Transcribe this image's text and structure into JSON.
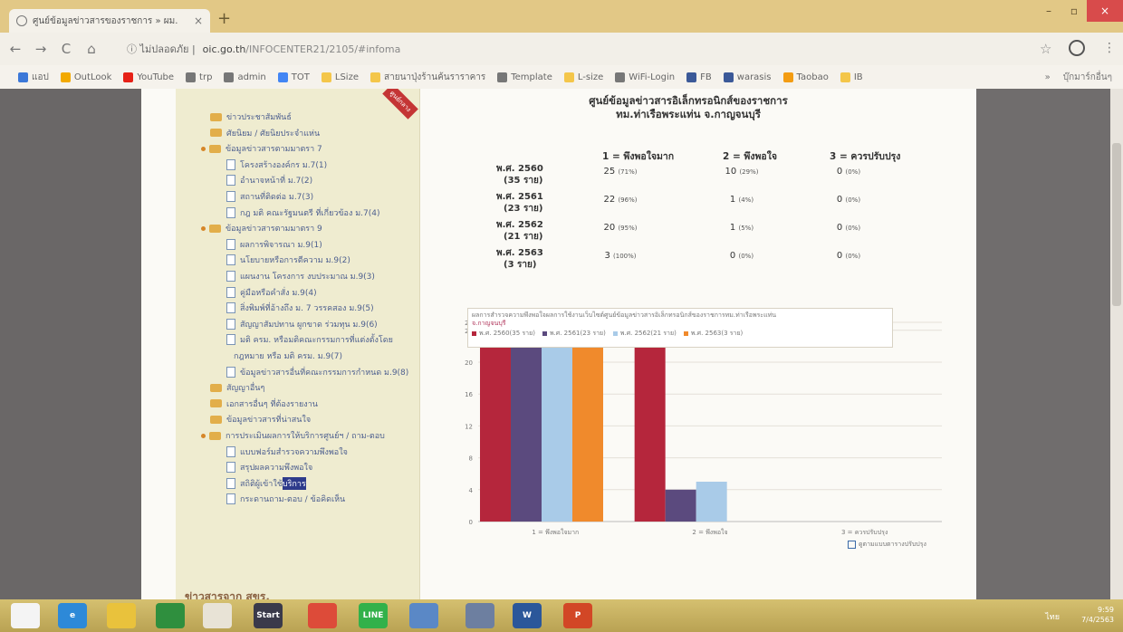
{
  "browser": {
    "tab_title": "ศูนย์ข้อมูลข่าวสารของราชการ » ผม.",
    "tab_close": "×",
    "new_tab": "+",
    "security_label": "ไม่ปลอดภัย",
    "url_domain": "oic.go.th",
    "url_path": "/INFOCENTER21/2105/#infoma",
    "nav_back": "←",
    "nav_forward": "→",
    "nav_reload": "C",
    "nav_home": "⌂",
    "window_controls": {
      "minimize": "–",
      "maximize": "▫",
      "close": "×"
    },
    "bookmarks": [
      {
        "label": "แอป",
        "color": "#3c78d8",
        "icon": "apps-icon"
      },
      {
        "label": "OutLook",
        "color": "#f2a900",
        "icon": "outlook-icon"
      },
      {
        "label": "YouTube",
        "color": "#e62117",
        "icon": "youtube-icon"
      },
      {
        "label": "trp",
        "color": "#777777",
        "icon": "globe-icon"
      },
      {
        "label": "admin",
        "color": "#777777",
        "icon": "globe-icon"
      },
      {
        "label": "TOT",
        "color": "#4285f4",
        "icon": "google-icon"
      },
      {
        "label": "LSize",
        "color": "#f4c64a",
        "icon": "folder-icon"
      },
      {
        "label": "สายนาปุ่งร้านค้นราราคาร",
        "color": "#f4c64a",
        "icon": "folder-icon"
      },
      {
        "label": "Template",
        "color": "#777777",
        "icon": "globe-icon"
      },
      {
        "label": "L-size",
        "color": "#f4c64a",
        "icon": "folder-icon"
      },
      {
        "label": "WiFi-Login",
        "color": "#777777",
        "icon": "globe-icon"
      },
      {
        "label": "FB",
        "color": "#3b5998",
        "icon": "facebook-icon"
      },
      {
        "label": "warasis",
        "color": "#3b5998",
        "icon": "facebook-icon"
      },
      {
        "label": "Taobao",
        "color": "#f39c12",
        "icon": "taobao-icon"
      },
      {
        "label": "IB",
        "color": "#f4c64a",
        "icon": "ib-icon"
      }
    ],
    "bookmarks_more": "»",
    "other_bookmarks": "บุ๊กมาร์กอื่นๆ"
  },
  "sidebar": {
    "ribbon": "ศูนย์กลาง",
    "items": [
      {
        "type": "folder",
        "dot": false,
        "indent": 0,
        "label": "ข่าวประชาสัมพันธ์"
      },
      {
        "type": "folder",
        "dot": false,
        "indent": 0,
        "label": "ศัยนิยม / ศัยนิยประจำแห่น"
      },
      {
        "type": "folder",
        "dot": true,
        "indent": 0,
        "label": "ข้อมูลข่าวสารตามมาตรา 7"
      },
      {
        "type": "doc",
        "dot": false,
        "indent": 1,
        "label": "โครงสร้างองค์กร ม.7(1)"
      },
      {
        "type": "doc",
        "dot": false,
        "indent": 1,
        "label": "อำนาจหน้าที่ ม.7(2)"
      },
      {
        "type": "doc",
        "dot": false,
        "indent": 1,
        "label": "สถานที่ติดต่อ ม.7(3)"
      },
      {
        "type": "doc",
        "dot": false,
        "indent": 1,
        "label": "กฎ มติ คณะรัฐมนตรี ที่เกี่ยวข้อง ม.7(4)"
      },
      {
        "type": "folder",
        "dot": true,
        "indent": 0,
        "label": "ข้อมูลข่าวสารตามมาตรา 9"
      },
      {
        "type": "doc",
        "dot": false,
        "indent": 1,
        "label": "ผลการพิจารณา ม.9(1)"
      },
      {
        "type": "doc",
        "dot": false,
        "indent": 1,
        "label": "นโยบายหรือการตีความ ม.9(2)"
      },
      {
        "type": "doc",
        "dot": false,
        "indent": 1,
        "label": "แผนงาน โครงการ งบประมาณ ม.9(3)"
      },
      {
        "type": "doc",
        "dot": false,
        "indent": 1,
        "label": "คู่มือหรือคำสั่ง ม.9(4)"
      },
      {
        "type": "doc",
        "dot": false,
        "indent": 1,
        "label": "สิ่งพิมพ์ที่อ้างถึง ม. 7 วรรคสอง ม.9(5)"
      },
      {
        "type": "doc",
        "dot": false,
        "indent": 1,
        "label": "สัญญาสัมปทาน ผูกขาด ร่วมทุน ม.9(6)"
      },
      {
        "type": "doc",
        "dot": false,
        "indent": 1,
        "label": "มติ ครม. หรือมติคณะกรรมการที่แต่งตั้งโดย"
      },
      {
        "type": "text",
        "dot": false,
        "indent": 2,
        "label": "กฎหมาย หรือ มติ ครม. ม.9(7)"
      },
      {
        "type": "doc",
        "dot": false,
        "indent": 1,
        "label": "ข้อมูลข่าวสารอื่นที่คณะกรรมการกำหนด ม.9(8)"
      },
      {
        "type": "folder",
        "dot": false,
        "indent": 0,
        "label": "สัญญาอื่นๆ"
      },
      {
        "type": "folder",
        "dot": false,
        "indent": 0,
        "label": "เอกสารอื่นๆ ที่ต้องรายงาน"
      },
      {
        "type": "folder",
        "dot": false,
        "indent": 0,
        "label": "ข้อมูลข่าวสารที่น่าสนใจ"
      },
      {
        "type": "folder",
        "dot": true,
        "indent": 0,
        "label": "การประเมินผลการให้บริการศูนย์ฯ / ถาม-ตอบ"
      },
      {
        "type": "doc",
        "dot": false,
        "indent": 1,
        "label": "แบบฟอร์มสำรวจความพึงพอใจ"
      },
      {
        "type": "doc",
        "dot": false,
        "indent": 1,
        "label": "สรุปผลความพึงพอใจ"
      },
      {
        "type": "doc",
        "dot": false,
        "indent": 1,
        "label": "สถิติผู้เข้าใช้บริการ",
        "selected_part": "บริการ"
      },
      {
        "type": "doc",
        "dot": false,
        "indent": 1,
        "label": "กระดานถาม-ตอบ / ข้อคิดเห็น"
      }
    ],
    "news_title": "ข่าวสารจาก สขร."
  },
  "main": {
    "title_line1": "ศูนย์ข้อมูลข่าวสารอิเล็กทรอนิกส์ของราชการ",
    "title_line2": "ทม.ท่าเรือพระแท่น จ.กาญจนบุรี",
    "columns": [
      "1 = พึงพอใจมาก",
      "2 = พึงพอใจ",
      "3 = ควรปรับปรุง"
    ],
    "rows": [
      {
        "year": "พ.ศ. 2560",
        "count": "(35 ราย)",
        "c1": "25",
        "p1": "(71%)",
        "c2": "10",
        "p2": "(29%)",
        "c3": "0",
        "p3": "(0%)"
      },
      {
        "year": "พ.ศ. 2561",
        "count": "(23 ราย)",
        "c1": "22",
        "p1": "(96%)",
        "c2": "1",
        "p2": "(4%)",
        "c3": "0",
        "p3": "(0%)"
      },
      {
        "year": "พ.ศ. 2562",
        "count": "(21 ราย)",
        "c1": "20",
        "p1": "(95%)",
        "c2": "1",
        "p2": "(5%)",
        "c3": "0",
        "p3": "(0%)"
      },
      {
        "year": "พ.ศ. 2563",
        "count": "(3 ราย)",
        "c1": "3",
        "p1": "(100%)",
        "c2": "0",
        "p2": "(0%)",
        "c3": "0",
        "p3": "(0%)"
      }
    ],
    "export_label": "ดูตามแบบตารางปรับปรุง"
  },
  "chart_data": {
    "type": "bar",
    "title": "ผลการสำรวจความพึงพอใจผลการใช้งานเว็บไซต์ศูนย์ข้อมูลข่าวสารอิเล็กทรอนิกส์ของราชการทม.ท่าเรือพระแท่น",
    "title_line2": "จ.กาญจนบุรี",
    "categories": [
      "1 = พึงพอใจมาก",
      "2 = พึงพอใจ",
      "3 = ควรปรับปรุง"
    ],
    "series": [
      {
        "name": "พ.ศ. 2560(35 ราย)",
        "color": "#b5263c",
        "values": [
          71,
          29,
          0
        ]
      },
      {
        "name": "พ.ศ. 2561(23 ราย)",
        "color": "#5b4a7e",
        "values": [
          96,
          4,
          0
        ]
      },
      {
        "name": "พ.ศ. 2562(21 ราย)",
        "color": "#a9cbe8",
        "values": [
          95,
          5,
          0
        ]
      },
      {
        "name": "พ.ศ. 2563(3 ราย)",
        "color": "#f08a2c",
        "values": [
          100,
          0,
          0
        ]
      }
    ],
    "ylim": [
      0,
      25
    ],
    "yticks": [
      0,
      4,
      8,
      12,
      16,
      20,
      24,
      25
    ],
    "grid": true,
    "legend": "top"
  },
  "taskbar": {
    "apps": [
      {
        "name": "start-button",
        "label": "",
        "color": "#f4f4f4"
      },
      {
        "name": "ie-icon",
        "label": "e",
        "color": "#2d89d8"
      },
      {
        "name": "explorer-icon",
        "label": "",
        "color": "#e9c23c"
      },
      {
        "name": "store-icon",
        "label": "",
        "color": "#2f8f3e"
      },
      {
        "name": "cloud-icon",
        "label": "",
        "color": "#e8e3d6"
      },
      {
        "name": "start-menu-icon",
        "label": "Start",
        "color": "#3a3a4a"
      },
      {
        "name": "chrome-icon",
        "label": "",
        "color": "#dd4b39"
      },
      {
        "name": "line-icon",
        "label": "LINE",
        "color": "#32b14a"
      },
      {
        "name": "pen-icon",
        "label": "",
        "color": "#5a88c6"
      },
      {
        "name": "calculator-icon",
        "label": "",
        "color": "#6d7fa0"
      },
      {
        "name": "word-icon",
        "label": "W",
        "color": "#2b579a"
      },
      {
        "name": "powerpoint-icon",
        "label": "P",
        "color": "#d24726"
      }
    ],
    "tray_lang": "ไทย",
    "time": "9:59",
    "date": "7/4/2563"
  }
}
